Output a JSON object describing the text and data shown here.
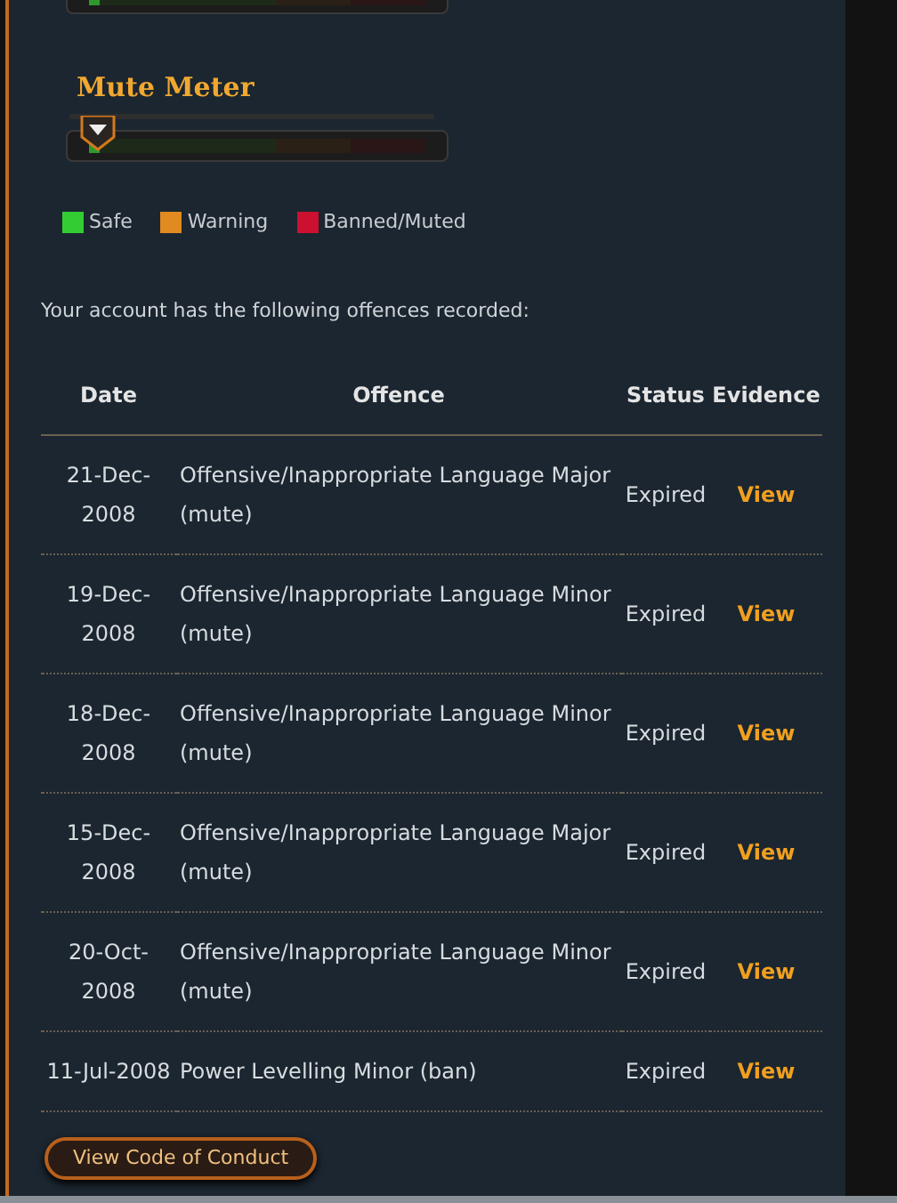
{
  "top_meter": {
    "level": 0.02
  },
  "mute_meter": {
    "title": "Mute Meter",
    "level": 0.02
  },
  "legend": [
    {
      "label": "Safe",
      "color": "#33cc33"
    },
    {
      "label": "Warning",
      "color": "#e08a20"
    },
    {
      "label": "Banned/Muted",
      "color": "#cc1030"
    }
  ],
  "intro": "Your account has the following offences recorded:",
  "table": {
    "columns": [
      "Date",
      "Offence",
      "Status",
      "Evidence"
    ],
    "rows": [
      {
        "date": "21-Dec-2008",
        "offence": "Offensive/Inappropriate Language Major (mute)",
        "status": "Expired",
        "evidence": "View"
      },
      {
        "date": "19-Dec-2008",
        "offence": "Offensive/Inappropriate Language Minor (mute)",
        "status": "Expired",
        "evidence": "View"
      },
      {
        "date": "18-Dec-2008",
        "offence": "Offensive/Inappropriate Language Minor (mute)",
        "status": "Expired",
        "evidence": "View"
      },
      {
        "date": "15-Dec-2008",
        "offence": "Offensive/Inappropriate Language Major (mute)",
        "status": "Expired",
        "evidence": "View"
      },
      {
        "date": "20-Oct-2008",
        "offence": "Offensive/Inappropriate Language Minor (mute)",
        "status": "Expired",
        "evidence": "View"
      },
      {
        "date": "11-Jul-2008",
        "offence": "Power Levelling Minor (ban)",
        "status": "Expired",
        "evidence": "View"
      }
    ]
  },
  "button": "View Code of Conduct"
}
